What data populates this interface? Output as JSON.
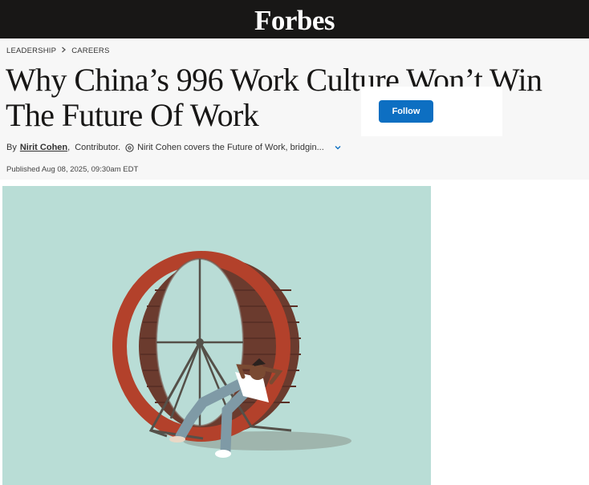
{
  "header": {
    "logo_text": "Forbes"
  },
  "breadcrumb": {
    "section": "LEADERSHIP",
    "subsection": "CAREERS"
  },
  "article": {
    "title": "Why China’s 996 Work Culture Won’t Win The Future Of Work",
    "by_label": "By",
    "author": "Nirit Cohen",
    "separator": ",",
    "role": "Contributor.",
    "bio": "Nirit Cohen covers the Future of Work, bridgin...",
    "published": "Published Aug 08, 2025, 09:30am EDT"
  },
  "follow": {
    "label": "Follow"
  },
  "colors": {
    "topbar": "#181716",
    "follow_button": "#0d6fc2",
    "image_background": "#b9ddd6",
    "wheel_red": "#b3412b",
    "wheel_inner": "#6b3b2e"
  },
  "icons": [
    "info-icon",
    "chevron-down-icon"
  ],
  "image": {
    "description_icon": "hamster-wheel-illustration"
  }
}
